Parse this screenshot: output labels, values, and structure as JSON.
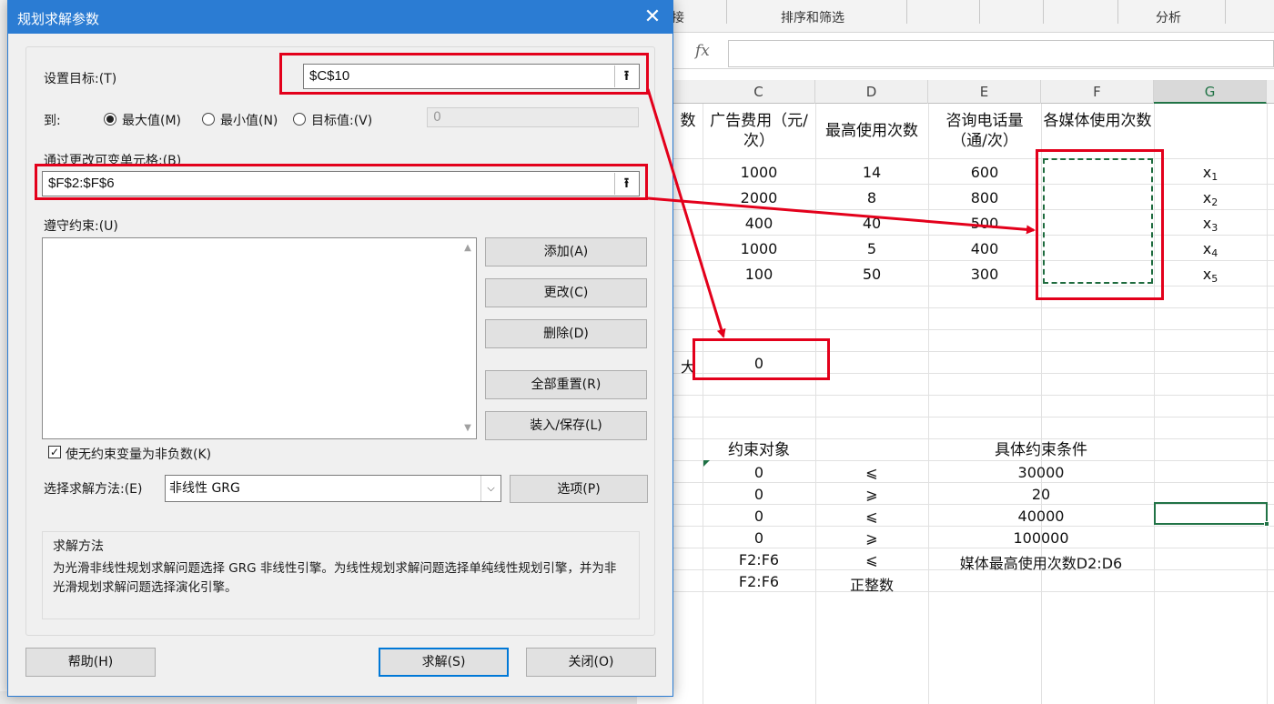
{
  "excel": {
    "ribbon_groups": [
      "接",
      "排序和筛选",
      "分析"
    ],
    "fx_label": "fx",
    "columns": [
      "C",
      "D",
      "E",
      "F",
      "G"
    ],
    "selected_column": "G",
    "headers": {
      "partial_b": "数",
      "c": "广告费用（元/次）",
      "d": "最高使用次数",
      "e": "咨询电话量（通/次）",
      "f": "各媒体使用次数"
    },
    "data_rows": [
      {
        "c": "1000",
        "d": "14",
        "e": "600",
        "g_var": "x",
        "g_sub": "1"
      },
      {
        "c": "2000",
        "d": "8",
        "e": "800",
        "g_var": "x",
        "g_sub": "2"
      },
      {
        "c": "400",
        "d": "40",
        "e": "500",
        "g_var": "x",
        "g_sub": "3"
      },
      {
        "c": "1000",
        "d": "5",
        "e": "400",
        "g_var": "x",
        "g_sub": "4"
      },
      {
        "c": "100",
        "d": "50",
        "e": "300",
        "g_var": "x",
        "g_sub": "5"
      }
    ],
    "objective": {
      "partial_label": "大",
      "value": "0"
    },
    "constraints_header": {
      "object": "约束对象",
      "condition": "具体约束条件"
    },
    "constraints": [
      {
        "obj": "0",
        "op": "⩽",
        "cond": "30000"
      },
      {
        "obj": "0",
        "op": "⩾",
        "cond": "20"
      },
      {
        "obj": "0",
        "op": "⩽",
        "cond": "40000"
      },
      {
        "obj": "0",
        "op": "⩾",
        "cond": "100000"
      },
      {
        "obj": "F2:F6",
        "op": "⩽",
        "cond": "媒体最高使用次数D2:D6"
      },
      {
        "obj": "F2:F6",
        "op": "正整数",
        "cond": ""
      }
    ]
  },
  "dialog": {
    "title": "规划求解参数",
    "close_symbol": "✕",
    "set_objective_label": "设置目标:(T)",
    "set_objective_value": "$C$10",
    "to_label": "到:",
    "radio_max": "最大值(M)",
    "radio_min": "最小值(N)",
    "radio_target": "目标值:(V)",
    "target_value": "0",
    "changing_cells_label": "通过更改可变单元格:(B)",
    "changing_cells_value": "$F$2:$F$6",
    "constraints_label": "遵守约束:(U)",
    "buttons": {
      "add": "添加(A)",
      "change": "更改(C)",
      "delete": "删除(D)",
      "reset_all": "全部重置(R)",
      "load_save": "装入/保存(L)",
      "options": "选项(P)",
      "help": "帮助(H)",
      "solve": "求解(S)",
      "close": "关闭(O)"
    },
    "nonneg_label": "使无约束变量为非负数(K)",
    "nonneg_checked": true,
    "method_label": "选择求解方法:(E)",
    "method_value": "非线性 GRG",
    "desc_title": "求解方法",
    "desc_text": "为光滑非线性规划求解问题选择 GRG 非线性引擎。为线性规划求解问题选择单纯线性规划引擎，并为非光滑规划求解问题选择演化引擎。"
  },
  "colors": {
    "title_bar": "#2b7cd3",
    "annotation_red": "#e3001b",
    "excel_green": "#217346"
  }
}
